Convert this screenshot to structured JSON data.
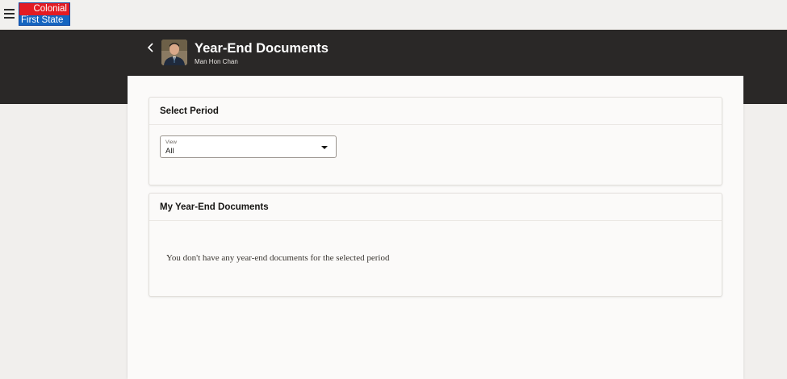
{
  "header": {
    "menu_icon": "hamburger-icon",
    "logo": {
      "line1": "Colonial",
      "line2": "First State",
      "top_color": "#e31b23",
      "bottom_color": "#1565c0"
    }
  },
  "hero": {
    "back_icon": "chevron-left-icon",
    "title": "Year-End Documents",
    "subtitle": "Man Hon Chan",
    "background": "#2a2827"
  },
  "period_card": {
    "title": "Select Period",
    "select": {
      "label": "View",
      "value": "All",
      "icon": "caret-down-icon"
    }
  },
  "documents_card": {
    "title": "My Year-End Documents",
    "empty_message": "You don't have any year-end documents for the selected period"
  }
}
